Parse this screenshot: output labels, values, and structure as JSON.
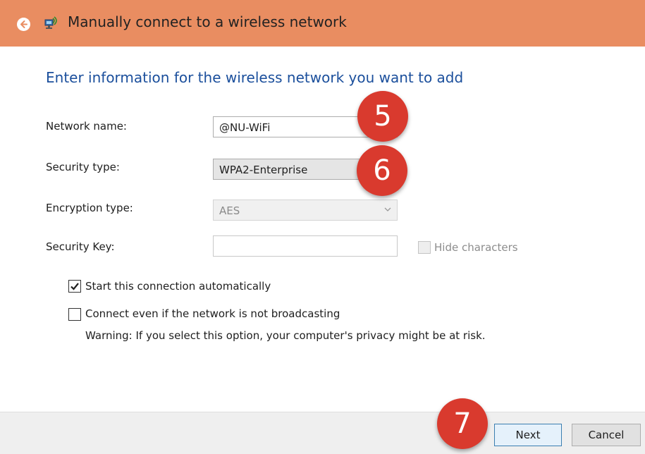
{
  "window": {
    "title": "Manually connect to a wireless network",
    "back_icon": "back-arrow-icon",
    "network_icon": "network-icon"
  },
  "form": {
    "heading": "Enter information for the wireless network you want to add",
    "network_name": {
      "label": "Network name:",
      "value": "@NU-WiFi"
    },
    "security_type": {
      "label": "Security type:",
      "value": "WPA2-Enterprise"
    },
    "encryption_type": {
      "label": "Encryption type:",
      "value": "AES"
    },
    "security_key": {
      "label": "Security Key:",
      "value": ""
    },
    "hide_characters": {
      "label": "Hide characters",
      "checked": false,
      "enabled": false
    },
    "start_automatically": {
      "label": "Start this connection automatically",
      "checked": true
    },
    "connect_not_broadcasting": {
      "label": "Connect even if the network is not broadcasting",
      "checked": false
    },
    "warning": "Warning: If you select this option, your computer's privacy might be at risk."
  },
  "buttons": {
    "next": "Next",
    "cancel": "Cancel"
  },
  "annotations": {
    "step_5": "5",
    "step_6": "6",
    "step_7": "7"
  },
  "colors": {
    "titlebar": "#e98d61",
    "heading": "#1b4f9c",
    "badge": "#d93a2e"
  }
}
